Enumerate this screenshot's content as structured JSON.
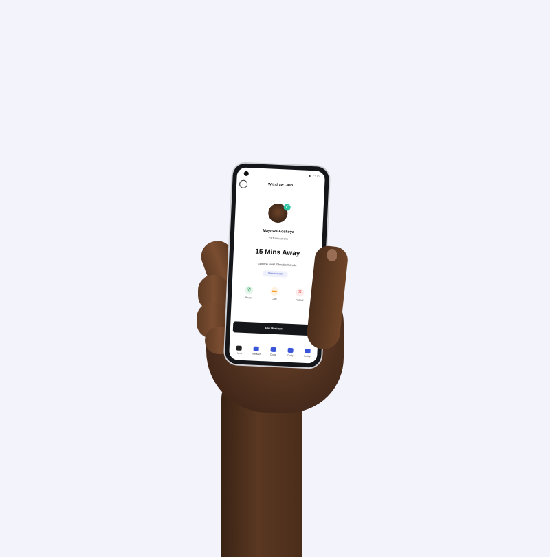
{
  "screen": {
    "title": "Withdraw Cash",
    "merchant_name": "Mayowa Adekoya",
    "transactions": "23 Transactions",
    "eta": "15 Mins Away",
    "address": "Gbingbo Field, Gbingbo Ikorodu",
    "view_maps_label": "View in maps",
    "actions": [
      {
        "label": "Phone",
        "icon": "phone-icon",
        "color": "#e8f7ee"
      },
      {
        "label": "Chat",
        "icon": "chat-icon",
        "color": "#fff1e0"
      },
      {
        "label": "Cancel",
        "icon": "cancel-icon",
        "color": "#fdecec"
      }
    ],
    "pay_label": "Pay Merchant",
    "nav": [
      {
        "label": "Home"
      },
      {
        "label": "Transact"
      },
      {
        "label": "Chats"
      },
      {
        "label": "Cards"
      },
      {
        "label": "Profile"
      }
    ]
  },
  "colors": {
    "background": "#f3f4fb",
    "accent": "#3a55d9",
    "verified": "#2ec4a1",
    "button": "#15161a"
  }
}
